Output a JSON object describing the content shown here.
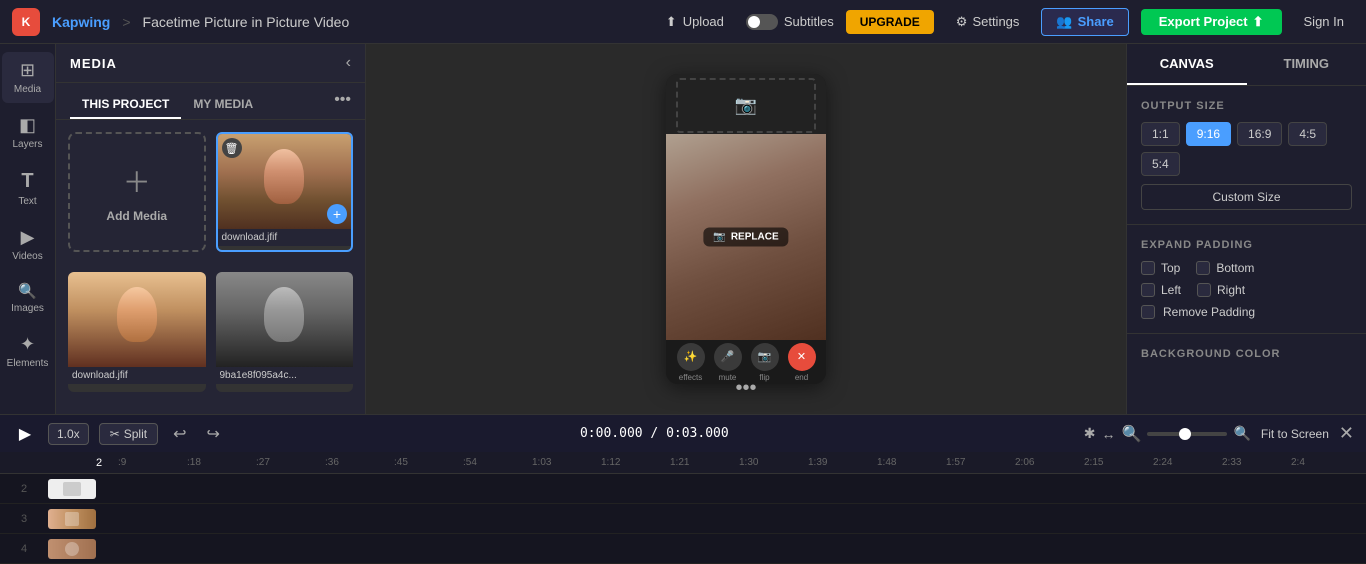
{
  "topbar": {
    "logo_text": "K",
    "brand": "Kapwing",
    "sep": ">",
    "title": "Facetime Picture in Picture Video",
    "upload_label": "Upload",
    "subtitles_label": "Subtitles",
    "upgrade_label": "UPGRADE",
    "settings_label": "Settings",
    "share_label": "Share",
    "export_label": "Export Project",
    "signin_label": "Sign In"
  },
  "sidebar": {
    "items": [
      {
        "id": "media",
        "icon": "⊞",
        "label": "Media",
        "active": true
      },
      {
        "id": "layers",
        "icon": "◧",
        "label": "Layers"
      },
      {
        "id": "text",
        "icon": "T",
        "label": "Text"
      },
      {
        "id": "videos",
        "icon": "▶",
        "label": "Videos"
      },
      {
        "id": "images",
        "icon": "🔍",
        "label": "Images"
      },
      {
        "id": "elements",
        "icon": "✦",
        "label": "Elements"
      }
    ]
  },
  "media_panel": {
    "title": "MEDIA",
    "tabs": [
      {
        "id": "this_project",
        "label": "THIS PROJECT",
        "active": true
      },
      {
        "id": "my_media",
        "label": "MY MEDIA"
      }
    ],
    "add_media_label": "Add Media",
    "files": [
      {
        "name": "download.jfif",
        "type": "girl"
      },
      {
        "name": "download.jfif",
        "type": "girl2"
      },
      {
        "name": "9ba1e8f095a4c...",
        "type": "boy"
      }
    ]
  },
  "canvas": {
    "replace_label": "REPLACE",
    "more_icon": "•••",
    "ctrl_labels": [
      "effects",
      "mute",
      "flip",
      "end"
    ]
  },
  "right_panel": {
    "tabs": [
      {
        "id": "canvas",
        "label": "CANVAS",
        "active": true
      },
      {
        "id": "timing",
        "label": "TIMING"
      }
    ],
    "output_size_title": "OUTPUT SIZE",
    "size_options": [
      "1:1",
      "9:16",
      "16:9",
      "4:5",
      "5:4"
    ],
    "active_size": "9:16",
    "custom_size_label": "Custom Size",
    "expand_padding_title": "EXPAND PADDING",
    "padding_options": [
      {
        "id": "top",
        "label": "Top"
      },
      {
        "id": "bottom",
        "label": "Bottom"
      },
      {
        "id": "left",
        "label": "Left"
      },
      {
        "id": "right",
        "label": "Right"
      }
    ],
    "remove_padding_label": "Remove Padding",
    "background_color_title": "BACKGROUND COLOR"
  },
  "bottom_bar": {
    "speed_label": "1.0x",
    "split_label": "Split",
    "timecode": "0:00.000 / 0:03.000",
    "fit_to_screen_label": "Fit to Screen"
  },
  "timeline": {
    "ruler_marks": [
      ":9",
      ":18",
      ":27",
      ":36",
      ":45",
      ":54",
      "1:03",
      "1:12",
      "1:21",
      "1:30",
      "1:39",
      "1:48",
      "1:57",
      "2:06",
      "2:15",
      "2:24",
      "2:33",
      "2:4"
    ],
    "tracks": [
      {
        "num": "2"
      },
      {
        "num": "3"
      },
      {
        "num": "4"
      }
    ]
  }
}
